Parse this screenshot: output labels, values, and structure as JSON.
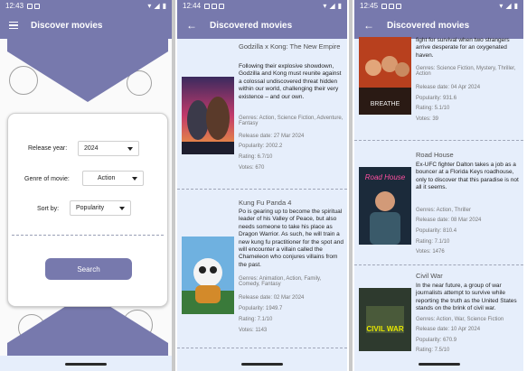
{
  "colors": {
    "primary": "#7779ad",
    "list_bg": "#e6eefb"
  },
  "screen1": {
    "status_time": "12:43",
    "title": "Discover movies",
    "menu_icon": "hamburger-menu-icon",
    "form": {
      "release_year_label": "Release year:",
      "release_year_value": "2024",
      "genre_label": "Genre of movie:",
      "genre_value": "Action",
      "sort_label": "Sort by:",
      "sort_value": "Popularity",
      "search_label": "Search"
    }
  },
  "screen2": {
    "status_time": "12:44",
    "title": "Discovered movies",
    "back_icon": "arrow-back-icon",
    "movies": [
      {
        "title": "Godzilla x Kong: The New Empire",
        "overview": "Following their explosive showdown, Godzilla and Kong must reunite against a colossal undiscovered threat hidden within our world, challenging their very existence – and our own.",
        "genres": "Genres: Action, Science Fiction, Adventure, Fantasy",
        "release": "Release date: 27 Mar 2024",
        "popularity": "Popularity: 2002.2",
        "rating": "Rating: 6.7/10",
        "votes": "Votes: 670"
      },
      {
        "title": "Kung Fu Panda 4",
        "overview": "Po is gearing up to become the spiritual leader of his Valley of Peace, but also needs someone to take his place as Dragon Warrior. As such, he will train a new kung fu practitioner for the spot and will encounter a villain called the Chameleon who conjures villains from the past.",
        "genres": "Genres: Animation, Action, Family, Comedy, Fantasy",
        "release": "Release date: 02 Mar 2024",
        "popularity": "Popularity: 1949.7",
        "rating": "Rating: 7.1/10",
        "votes": "Votes: 1143"
      }
    ]
  },
  "screen3": {
    "status_time": "12:45",
    "title": "Discovered movies",
    "back_icon": "arrow-back-icon",
    "movies": [
      {
        "title": "",
        "overview_tail": "fight for survival when two strangers arrive desperate for an oxygenated haven.",
        "genres": "Genres: Science Fiction, Mystery, Thriller, Action",
        "release": "Release date: 04 Apr 2024",
        "popularity": "Popularity: 931.6",
        "rating": "Rating: 5.1/10",
        "votes": "Votes: 39",
        "poster_text": "BREATHE"
      },
      {
        "title": "Road House",
        "overview": "Ex-UFC fighter Dalton takes a job as a bouncer at a Florida Keys roadhouse, only to discover that this paradise is not all it seems.",
        "genres": "Genres: Action, Thriller",
        "release": "Release date: 08 Mar 2024",
        "popularity": "Popularity: 810.4",
        "rating": "Rating: 7.1/10",
        "votes": "Votes: 1476"
      },
      {
        "title": "Civil War",
        "overview": "In the near future, a group of war journalists attempt to survive while reporting the truth as the United States stands on the brink of civil war.",
        "genres": "Genres: Action, War, Science Fiction",
        "release": "Release date: 10 Apr 2024",
        "popularity": "Popularity: 670.9",
        "rating": "Rating: 7.5/10",
        "poster_text": "CIVIL WAR"
      }
    ]
  }
}
